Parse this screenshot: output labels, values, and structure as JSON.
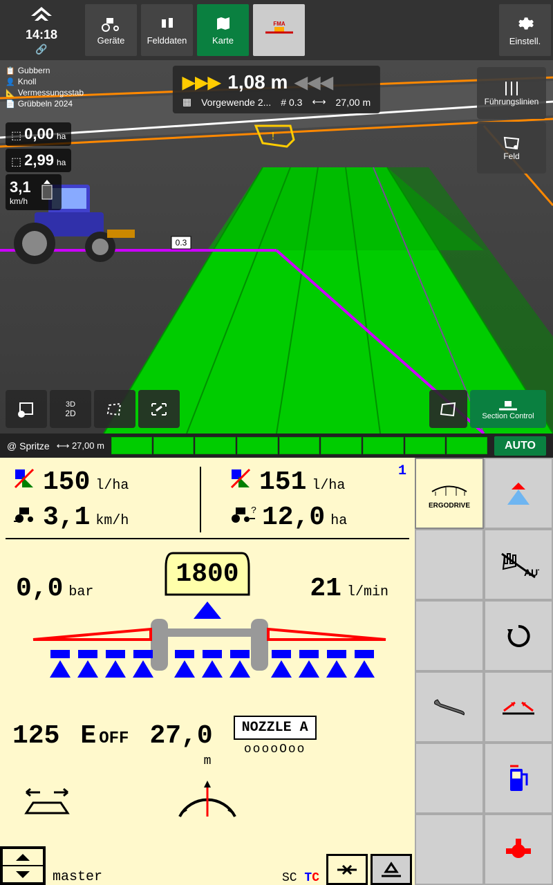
{
  "clock": "14:18",
  "topnav": {
    "devices": "Geräte",
    "fielddata": "Felddaten",
    "map": "Karte",
    "fma": "FMA",
    "settings": "Einstell."
  },
  "info": {
    "field": "Gubbern",
    "operator": "Knoll",
    "tool": "Vermessungsstab",
    "job": "Grübbeln 2024"
  },
  "stats": {
    "worked": "0,00",
    "total": "2,99",
    "unit": "ha",
    "speed": "3,1",
    "speed_unit": "km/h"
  },
  "guidance": {
    "offset": "1,08 m",
    "headland": "Vorgewende 2...",
    "track": "# 0.3",
    "width": "27,00 m"
  },
  "rightpanel": {
    "lines": "Führungslinien",
    "field": "Feld"
  },
  "track_marker": "0.3",
  "view_controls": {
    "mode3d": "3D",
    "mode2d": "2D"
  },
  "section_control": "Section Control",
  "sectionbar": {
    "label": "@ Spritze",
    "width": "27,00 m",
    "auto": "AUTO"
  },
  "implement": {
    "page": "1",
    "rate_actual": "150",
    "rate_unit": "l/ha",
    "rate_target": "151",
    "speed": "3,1",
    "speed_unit": "km/h",
    "area": "12,0",
    "area_unit": "ha",
    "pressure": "0,0",
    "pressure_unit": "bar",
    "tank": "1800",
    "flow": "21",
    "flow_unit": "l/min",
    "value125": "125",
    "eoff_e": "E",
    "eoff_off": "OFF",
    "width": "27,0",
    "width_unit": "m",
    "nozzle": "NOZZLE A",
    "circles": "ooooOoo",
    "master": "master",
    "sc": "SC",
    "side": {
      "ergodrive": "ERGODRIVE",
      "auto": "AUTO"
    }
  }
}
